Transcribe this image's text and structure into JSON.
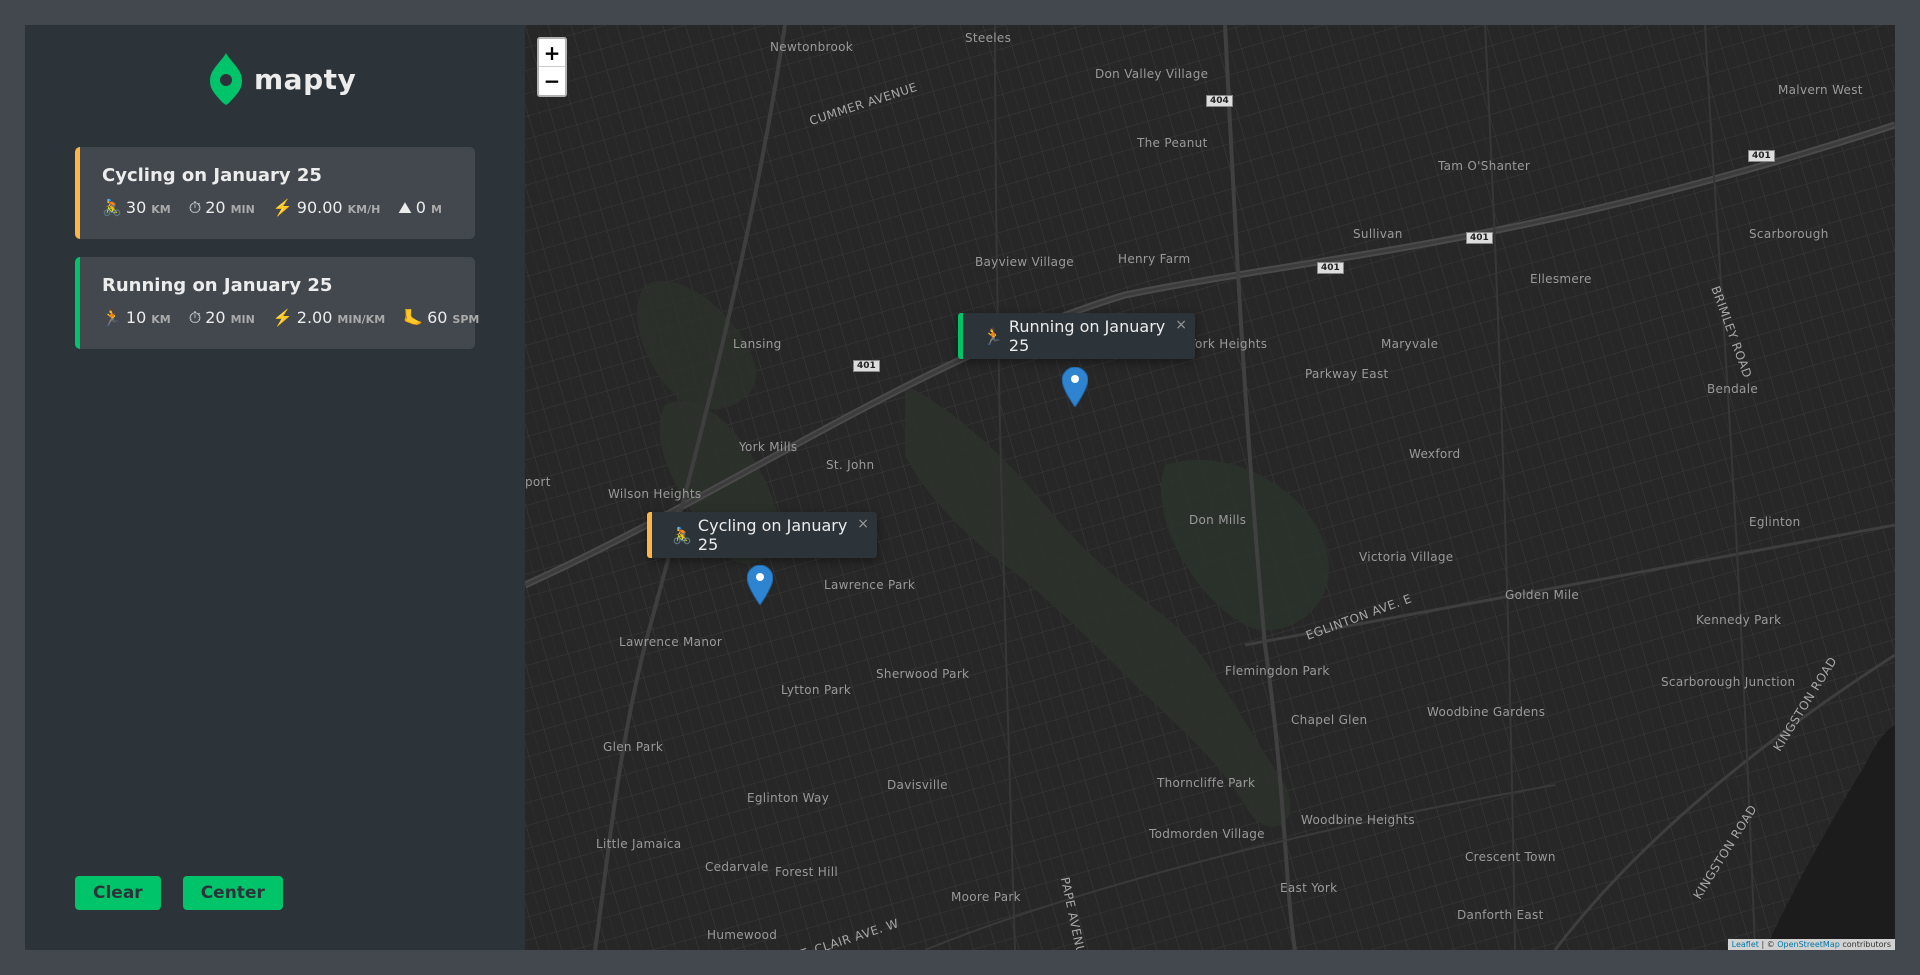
{
  "app": {
    "logo_text": "mapty",
    "logo_icon": "map-pin-icon"
  },
  "workouts": [
    {
      "title": "Cycling on January 25",
      "type": "cycling",
      "accent": "#ffb545",
      "details": [
        {
          "icon": "🚴",
          "value": "30",
          "unit": "km"
        },
        {
          "icon": "⏱",
          "value": "20",
          "unit": "min"
        },
        {
          "icon": "⚡️",
          "value": "90.00",
          "unit": "km/h"
        },
        {
          "icon": "⛰",
          "value": "0",
          "unit": "m"
        }
      ]
    },
    {
      "title": "Running on January 25",
      "type": "running",
      "accent": "#00c46a",
      "details": [
        {
          "icon": "🏃",
          "value": "10",
          "unit": "km"
        },
        {
          "icon": "⏱",
          "value": "20",
          "unit": "min"
        },
        {
          "icon": "⚡️",
          "value": "2.00",
          "unit": "min/km"
        },
        {
          "icon": "🦶",
          "value": "60",
          "unit": "spm"
        }
      ]
    }
  ],
  "buttons": {
    "clear": "Clear",
    "center": "Center"
  },
  "map": {
    "zoom_in": "+",
    "zoom_out": "−",
    "popups": {
      "running": {
        "icon": "🏃",
        "text": "Running on January 25",
        "close": "×"
      },
      "cycling": {
        "icon": "🚴",
        "text": "Cycling on January 25",
        "close": "×"
      }
    },
    "labels": [
      "Newtonbrook",
      "Steeles",
      "Don Valley Village",
      "Malvern West",
      "The Peanut",
      "Tam O'Shanter",
      "Sullivan",
      "Scarborough",
      "Bayview Village",
      "Henry Farm",
      "Ellesmere",
      "Lansing",
      "York Heights",
      "Maryvale",
      "Parkway East",
      "Bendale",
      "York Mills",
      "St. John",
      "Wexford",
      "Wilson Heights",
      "Don Mills",
      "Eglinton",
      "Victoria Village",
      "Golden Mile",
      "Lawrence Park",
      "Kennedy Park",
      "Lawrence Manor",
      "Sherwood Park",
      "Flemingdon Park",
      "Scarborough Junction",
      "Lytton Park",
      "Chapel Glen",
      "Woodbine Gardens",
      "Glen Park",
      "Thorncliffe Park",
      "Eglinton Way",
      "Davisville",
      "Woodbine Heights",
      "Little Jamaica",
      "Todmorden Village",
      "Crescent Town",
      "Cedarvale",
      "Forest Hill",
      "East York",
      "Moore Park",
      "Danforth East",
      "Humewood",
      "port"
    ],
    "road_labels": [
      "CUMMER AVENUE",
      "EGLINTON AVE. E",
      "BRIMLEY ROAD",
      "KINGSTON ROAD",
      "KINGSTON ROAD",
      "ST. CLAIR AVE. W",
      "PAPE AVENUE"
    ],
    "shields": [
      "404",
      "401",
      "401",
      "401",
      "401"
    ],
    "attribution": {
      "leaflet": "Leaflet",
      "sep": " | © ",
      "osm": "OpenStreetMap",
      "suffix": " contributors"
    }
  }
}
